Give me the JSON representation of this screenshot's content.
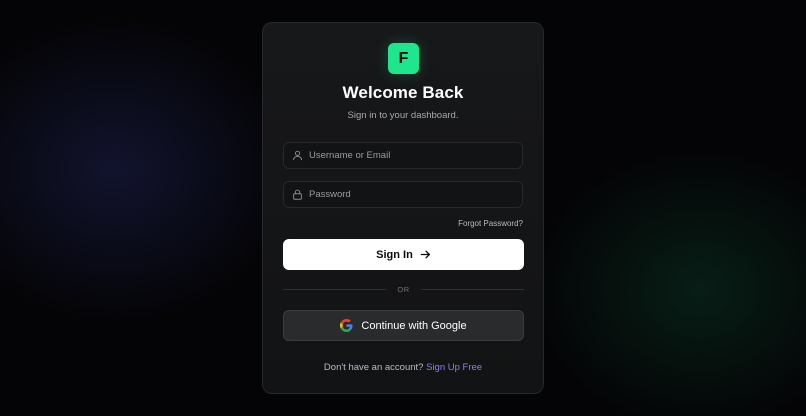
{
  "brand": {
    "logo_letter": "F",
    "accent": "#1fe58c"
  },
  "header": {
    "title": "Welcome Back",
    "subtitle": "Sign in to your dashboard."
  },
  "form": {
    "username": {
      "placeholder": "Username or Email",
      "value": "",
      "icon": "user-icon"
    },
    "password": {
      "placeholder": "Password",
      "value": "",
      "icon": "lock-icon"
    },
    "forgot_label": "Forgot Password?",
    "submit_label": "Sign In",
    "submit_icon": "arrow-right-icon"
  },
  "divider_label": "OR",
  "google": {
    "label": "Continue with Google",
    "icon": "google-icon"
  },
  "footer": {
    "prompt": "Don't have an account?",
    "link_label": "Sign Up Free",
    "link_color": "#8b7cf6"
  }
}
